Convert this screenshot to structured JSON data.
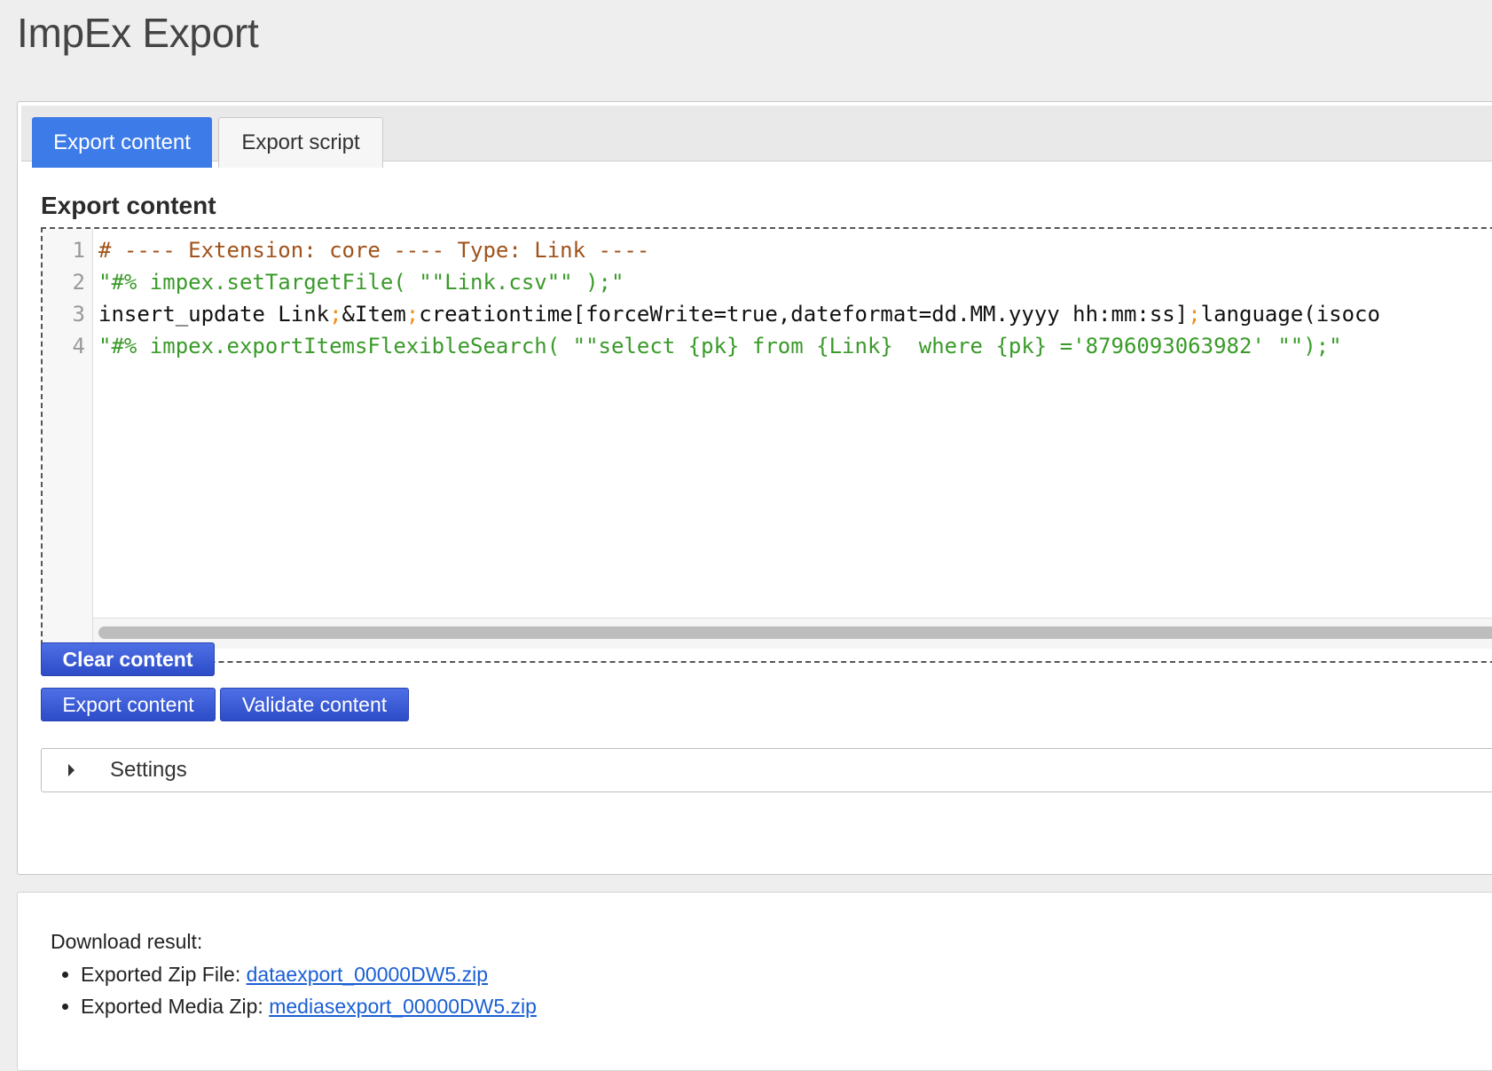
{
  "page": {
    "title": "ImpEx Export"
  },
  "tabs": [
    {
      "label": "Export content",
      "active": true
    },
    {
      "label": "Export script",
      "active": false
    }
  ],
  "editor": {
    "heading": "Export content",
    "lines": [
      {
        "number": "1",
        "text": "# ---- Extension: core ---- Type: Link ----"
      },
      {
        "number": "2",
        "text": "\"#% impex.setTargetFile( \"\"Link.csv\"\" );\""
      },
      {
        "number": "3",
        "parts": [
          "insert_update Link",
          ";",
          "&Item",
          ";",
          "creationtime[forceWrite=true,dateformat=dd.MM.yyyy hh:mm:ss]",
          ";",
          "language(isoco"
        ]
      },
      {
        "number": "4",
        "text": "\"#% impex.exportItemsFlexibleSearch( \"\"select {pk} from {Link}  where {pk} ='8796093063982' \"\");\""
      }
    ]
  },
  "buttons": {
    "clear": "Clear content",
    "export": "Export content",
    "validate": "Validate content"
  },
  "settings": {
    "label": "Settings",
    "expanded": false
  },
  "result": {
    "label": "Download result:",
    "items": [
      {
        "prefix": "Exported Zip File: ",
        "link": "dataexport_00000DW5.zip"
      },
      {
        "prefix": "Exported Media Zip: ",
        "link": "mediasexport_00000DW5.zip"
      }
    ]
  },
  "colors": {
    "tab_active": "#3d7be8",
    "button": "#3556d6",
    "comment": "#a0521a",
    "string": "#3a9a2a",
    "semicolon": "#f08c1a",
    "link": "#1a5fd4"
  }
}
